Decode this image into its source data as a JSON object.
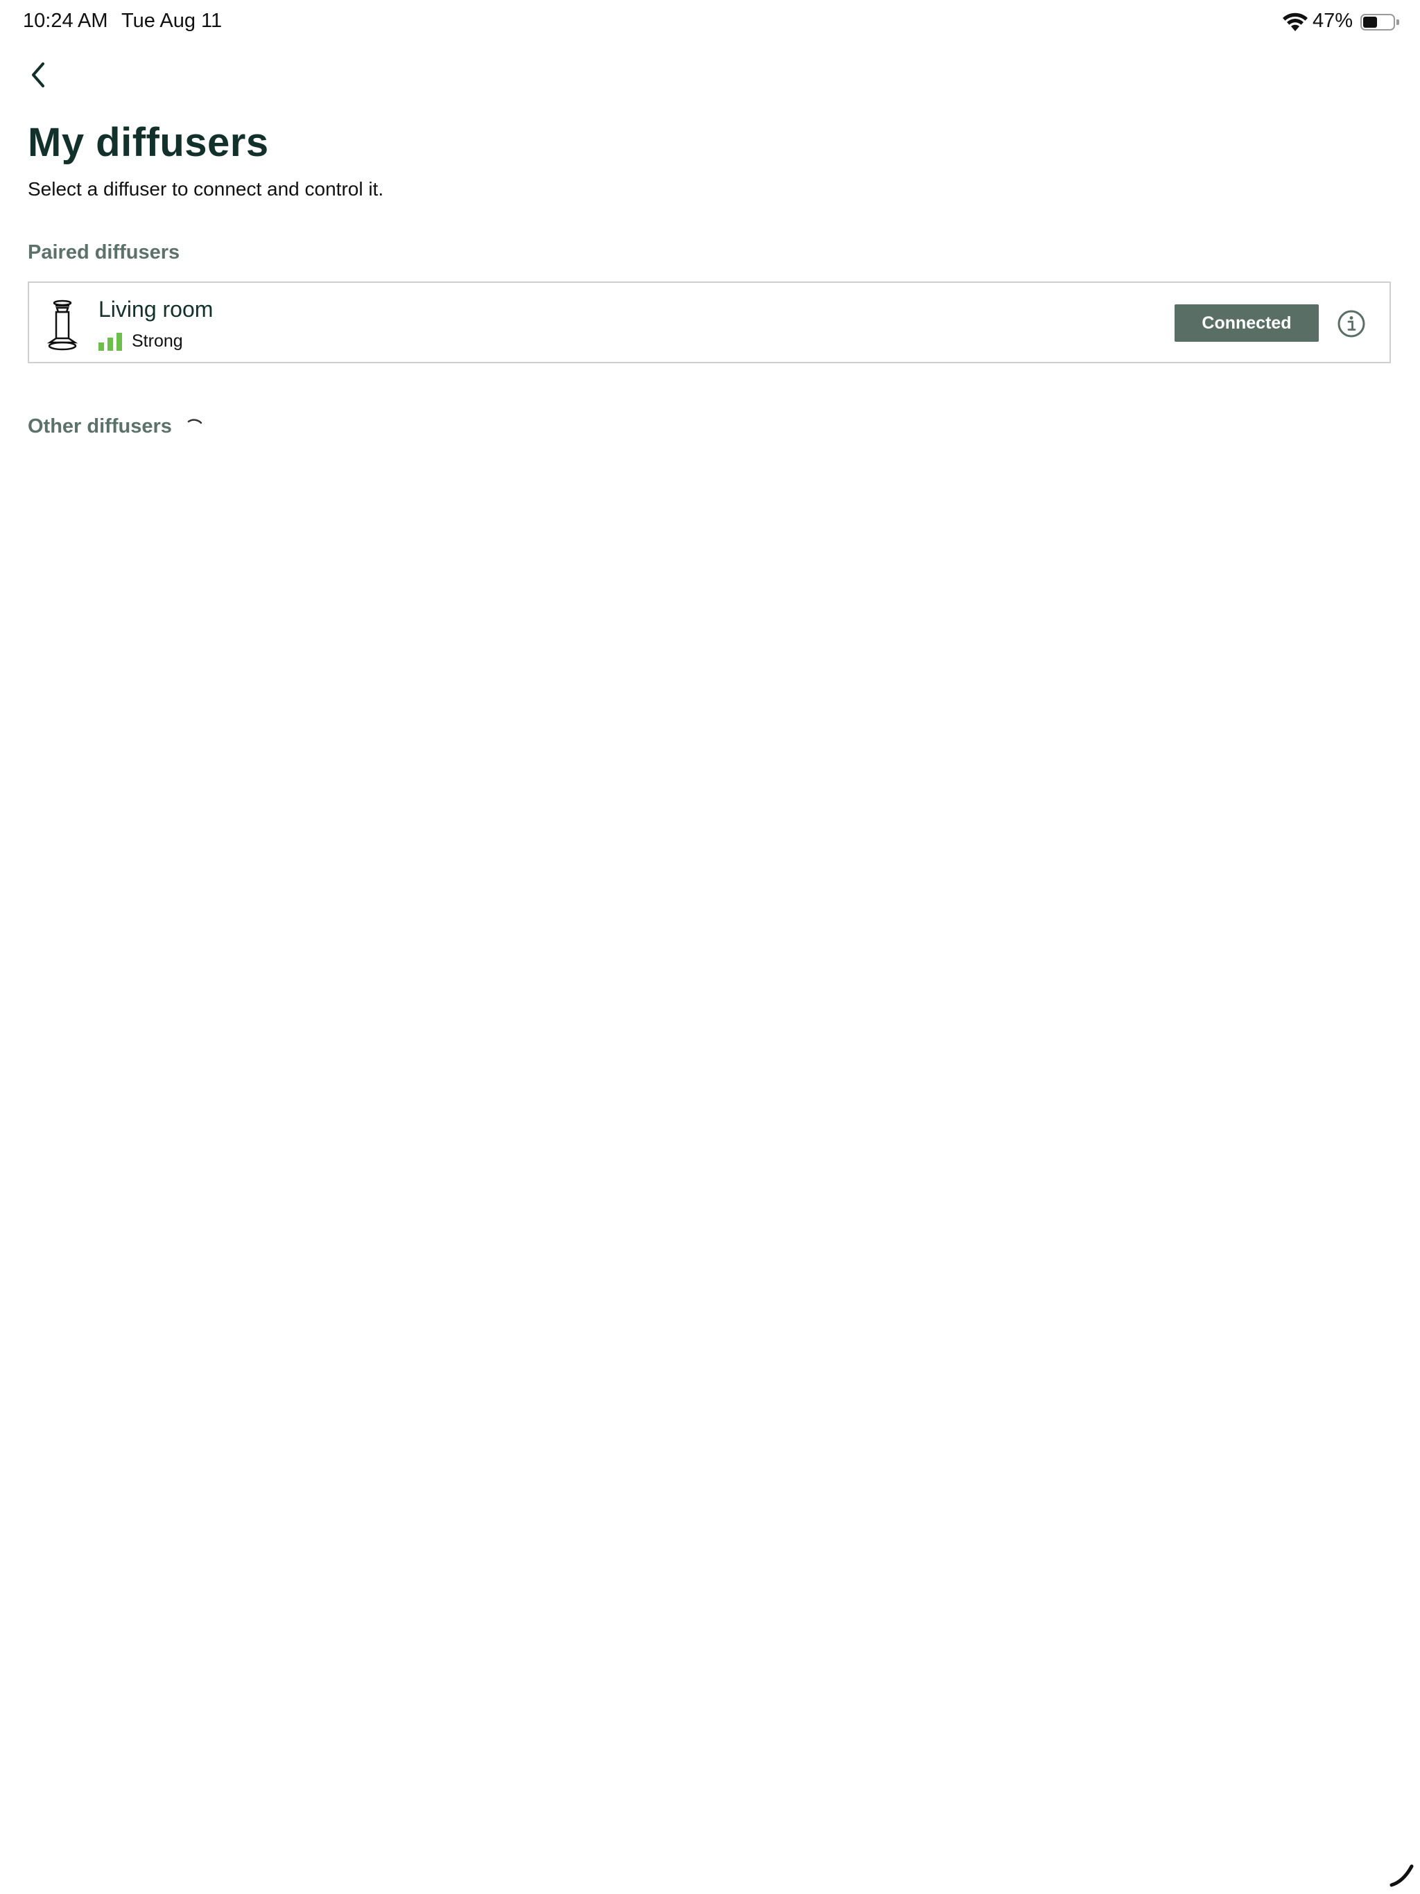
{
  "status_bar": {
    "time": "10:24 AM",
    "date": "Tue Aug 11",
    "battery_percent": "47%",
    "battery_level": 0.47,
    "icons": [
      "wifi-icon",
      "battery-icon"
    ]
  },
  "header": {
    "back_icon": "chevron-left-icon",
    "title": "My diffusers",
    "subtitle": "Select a diffuser to connect and control it."
  },
  "paired_section": {
    "label": "Paired diffusers",
    "devices": [
      {
        "name": "Living room",
        "icon": "diffuser-icon",
        "signal_label": "Strong",
        "signal_bars": 3,
        "signal_color": "#6cbf4a",
        "status_button": "Connected",
        "status_button_color": "#596e65",
        "info_icon": "info-icon"
      }
    ]
  },
  "other_section": {
    "label": "Other diffusers",
    "loading_icon": "loading-spinner-icon"
  },
  "colors": {
    "title": "#12312a",
    "section_label": "#5b7169",
    "card_border": "#cfcfcf"
  }
}
